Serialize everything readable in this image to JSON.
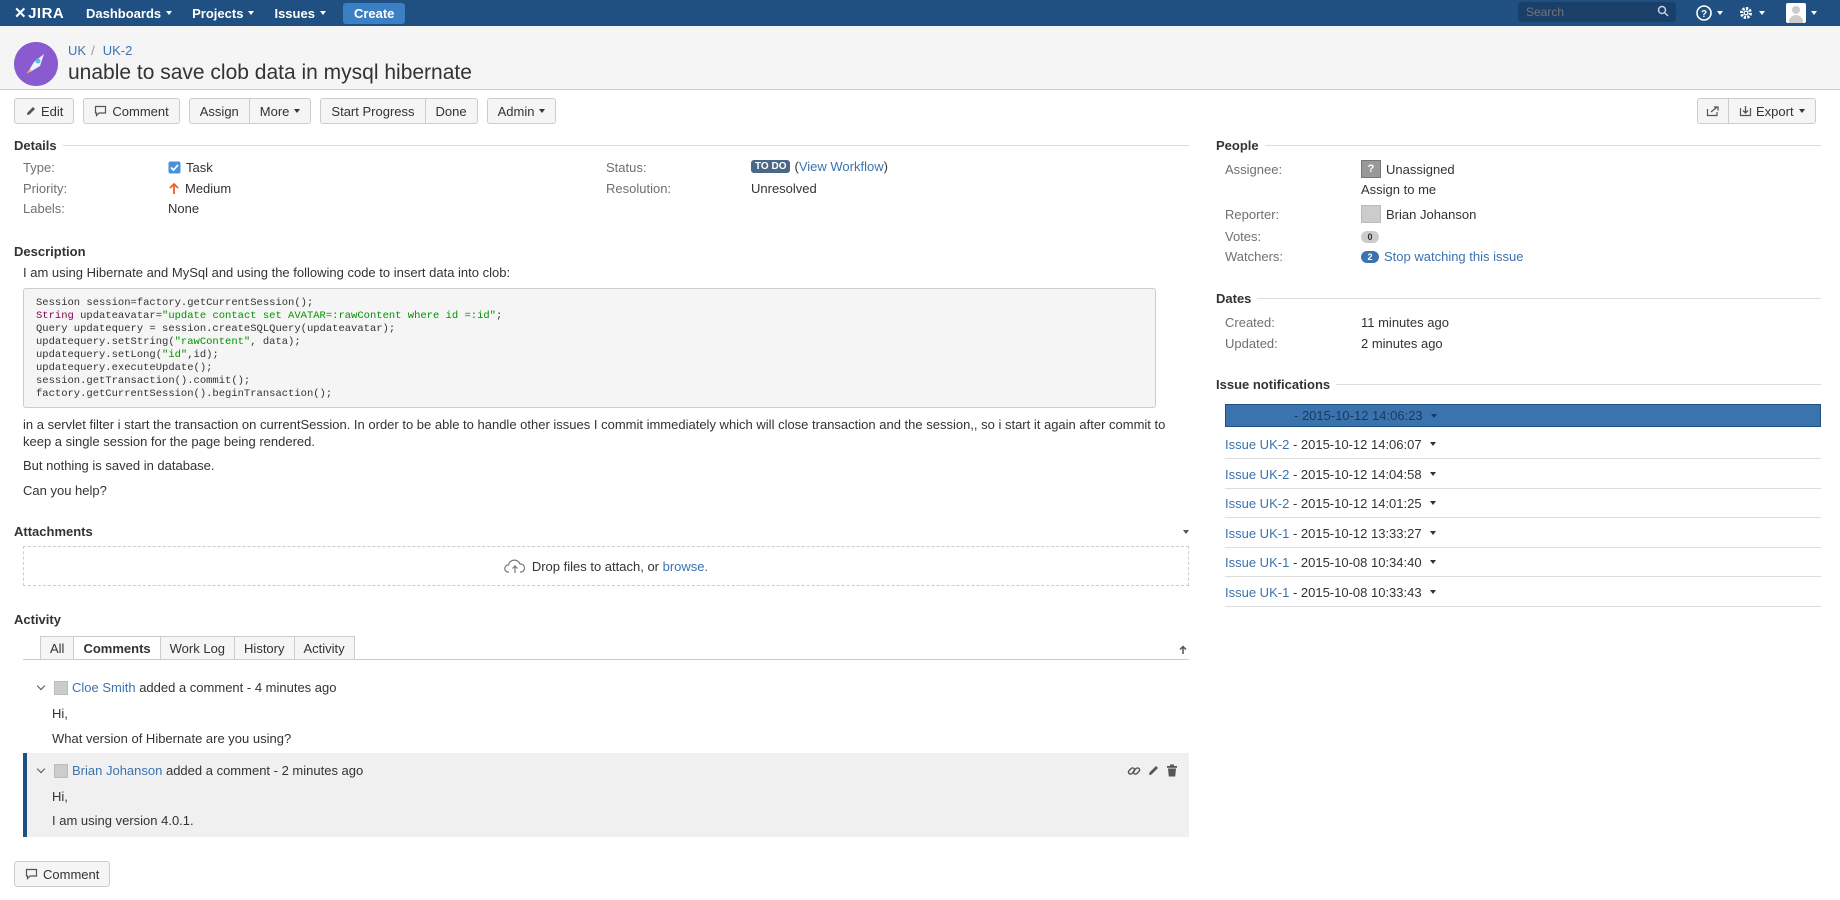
{
  "topbar": {
    "logo": "JIRA",
    "nav": [
      "Dashboards",
      "Projects",
      "Issues"
    ],
    "create": "Create",
    "search_placeholder": "Search"
  },
  "header": {
    "breadcrumb": [
      "UK",
      "UK-2"
    ],
    "title": "unable to save clob data in mysql hibernate"
  },
  "toolbar": {
    "edit": "Edit",
    "comment": "Comment",
    "assign": "Assign",
    "more": "More",
    "start_progress": "Start Progress",
    "done": "Done",
    "admin": "Admin",
    "export": "Export"
  },
  "details": {
    "heading": "Details",
    "type_label": "Type:",
    "type_value": "Task",
    "priority_label": "Priority:",
    "priority_value": "Medium",
    "labels_label": "Labels:",
    "labels_value": "None",
    "status_label": "Status:",
    "status_value": "TO DO",
    "view_workflow": "View Workflow",
    "resolution_label": "Resolution:",
    "resolution_value": "Unresolved"
  },
  "description": {
    "heading": "Description",
    "intro": "I am using Hibernate and MySql and using the following code to insert data into clob:",
    "code": [
      "Session session=factory.getCurrentSession();",
      "String updateavatar=\"update contact set AVATAR=:rawContent where id =:id\";",
      "Query updatequery = session.createSQLQuery(updateavatar);",
      "updatequery.setString(\"rawContent\", data);",
      "updatequery.setLong(\"id\",id);",
      "updatequery.executeUpdate();",
      "session.getTransaction().commit();",
      "factory.getCurrentSession().beginTransaction();"
    ],
    "para1": "in a servlet filter i start the transaction on currentSession. In order to be able to handle other issues I commit immediately which will close transaction and the session,, so i start it again after commit to keep a single session for the page being rendered.",
    "para2": "But nothing is saved in database.",
    "para3": "Can you help?"
  },
  "attachments": {
    "heading": "Attachments",
    "drop_text": "Drop files to attach, or",
    "browse": "browse."
  },
  "activity": {
    "heading": "Activity",
    "tabs": [
      "All",
      "Comments",
      "Work Log",
      "History",
      "Activity"
    ],
    "active_tab": "Comments",
    "comments": [
      {
        "author": "Cloe Smith",
        "meta": "added a comment - 4 minutes ago",
        "lines": [
          "Hi,",
          "What version of Hibernate are you using?"
        ]
      },
      {
        "author": "Brian Johanson",
        "meta": "added a comment - 2 minutes ago",
        "lines": [
          "Hi,",
          "I am using version 4.0.1."
        ]
      }
    ],
    "comment_button": "Comment"
  },
  "people": {
    "heading": "People",
    "assignee_label": "Assignee:",
    "assignee_value": "Unassigned",
    "assign_to_me": "Assign to me",
    "reporter_label": "Reporter:",
    "reporter_value": "Brian Johanson",
    "votes_label": "Votes:",
    "votes_count": "0",
    "watchers_label": "Watchers:",
    "watchers_count": "2",
    "watch_link": "Stop watching this issue"
  },
  "dates": {
    "heading": "Dates",
    "created_label": "Created:",
    "created_value": "11 minutes ago",
    "updated_label": "Updated:",
    "updated_value": "2 minutes ago"
  },
  "notifications": {
    "heading": "Issue notifications",
    "items": [
      {
        "issue": "",
        "time": "- 2015-10-12 14:06:23"
      },
      {
        "issue": "Issue UK-2",
        "time": "- 2015-10-12 14:06:07"
      },
      {
        "issue": "Issue UK-2",
        "time": "- 2015-10-12 14:04:58"
      },
      {
        "issue": "Issue UK-2",
        "time": "- 2015-10-12 14:01:25"
      },
      {
        "issue": "Issue UK-1",
        "time": "- 2015-10-12 13:33:27"
      },
      {
        "issue": "Issue UK-1",
        "time": "- 2015-10-08 10:34:40"
      },
      {
        "issue": "Issue UK-1",
        "time": "- 2015-10-08 10:33:43"
      }
    ]
  },
  "colors": {
    "topbar": "#205081",
    "create": "#3b7fc4",
    "link": "#3b73af",
    "selected_notification": "#3b73af"
  }
}
